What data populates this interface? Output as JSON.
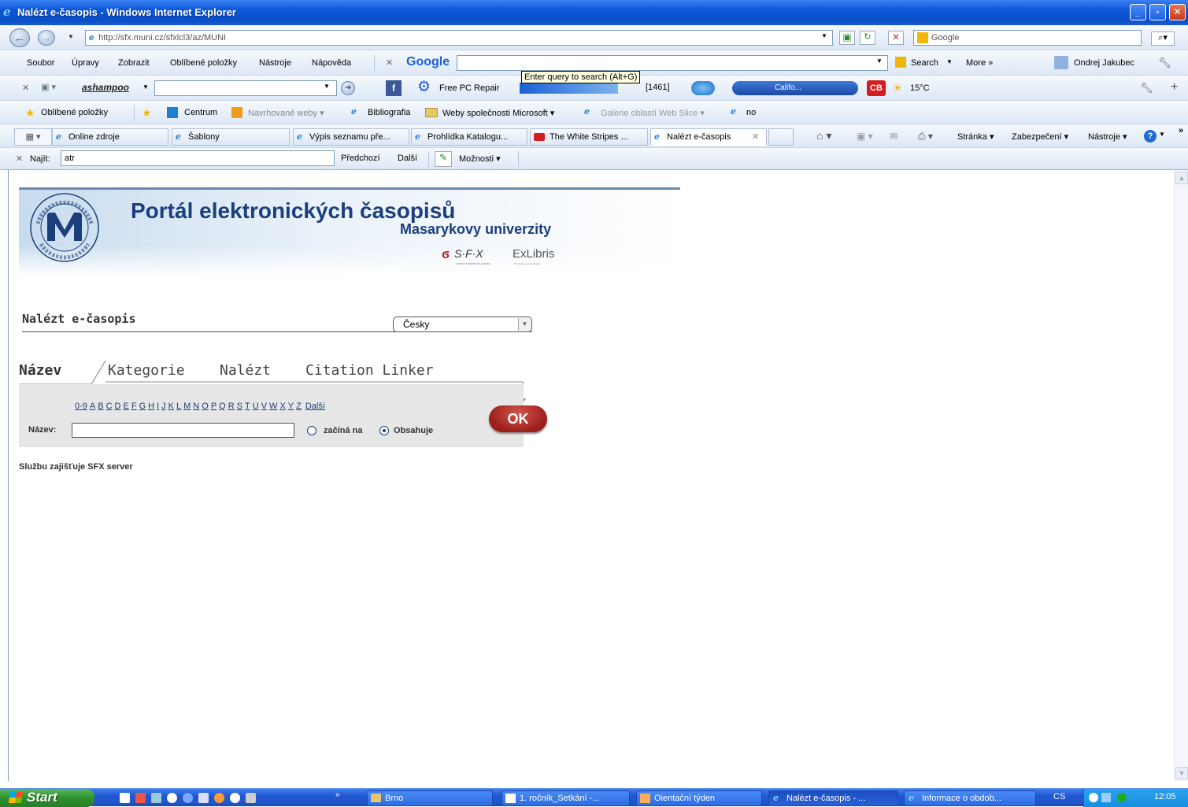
{
  "window": {
    "title": "Nalézt e-časopis - Windows Internet Explorer",
    "minimize": "_",
    "maximize": "▫",
    "close": "✕"
  },
  "address_bar": {
    "url": "http://sfx.muni.cz/sfxlcl3/az/MUNI",
    "search_placeholder": "Google"
  },
  "menu": {
    "items": [
      "Soubor",
      "Úpravy",
      "Zobrazit",
      "Oblíbené položky",
      "Nástroje",
      "Nápověda"
    ]
  },
  "google_toolbar": {
    "logo": "Google",
    "search_button": "Search",
    "more": "More »",
    "user": "Ondrej Jakubec"
  },
  "tooltip": "Enter query to search (Alt+G)",
  "ashampoo_toolbar": {
    "logo": "ashampoo",
    "free_pc_repair": "Free PC Repair",
    "mail_count": "[1461]",
    "radio": "Califo...",
    "cb": "CB",
    "weather": "15°C"
  },
  "favorites_bar": {
    "favorites_label": "Oblíbené položky",
    "items": [
      "Centrum",
      "Navrhované weby ▾",
      "Bibliografia",
      "Weby společnosti Microsoft ▾",
      "Galerie oblastí Web Slice ▾",
      "no"
    ]
  },
  "tabs": [
    {
      "label": "Online zdroje"
    },
    {
      "label": "Šablony"
    },
    {
      "label": "Výpis seznamu pře..."
    },
    {
      "label": "Prohlídka Katalogu..."
    },
    {
      "label": "The White Stripes ..."
    },
    {
      "label": "Nalézt e-časopis"
    }
  ],
  "command_bar": {
    "page": "Stránka ▾",
    "security": "Zabezpečení ▾",
    "tools": "Nástroje ▾",
    "more": "»"
  },
  "find_bar": {
    "label": "Najít:",
    "value": "atr",
    "prev": "Předchozí",
    "next": "Další",
    "options": "Možnosti ▾"
  },
  "page": {
    "banner": {
      "title": "Portál elektronických časopisů",
      "subtitle": "Masarykovy univerzity",
      "logo_letters": "MU",
      "sfx": "S·F·X",
      "sfx_tag": "CONTEXT SENSITIVE LINKING",
      "exlibris": "ExLibris",
      "exlibris_tag": "The bridge to knowledge"
    },
    "heading": "Nalézt e-časopis",
    "language": "Česky",
    "search_tabs": [
      "Název",
      "Kategorie",
      "Nalézt",
      "Citation Linker"
    ],
    "letters": [
      "0-9",
      "A",
      "B",
      "C",
      "D",
      "E",
      "F",
      "G",
      "H",
      "I",
      "J",
      "K",
      "L",
      "M",
      "N",
      "O",
      "P",
      "Q",
      "R",
      "S",
      "T",
      "U",
      "V",
      "W",
      "X",
      "Y",
      "Z",
      "Další"
    ],
    "title_label": "Název:",
    "title_value": "",
    "starts_with": "začíná na",
    "contains": "Obsahuje",
    "ok": "OK",
    "footer": "Službu zajišťuje SFX server"
  },
  "taskbar": {
    "start": "Start",
    "tasks": [
      "Brno",
      "1. ročník_Setkání -...",
      "Oientační týden",
      "Nalézt e-časopis - ...",
      "Informace o obdob..."
    ],
    "lang": "CS",
    "clock": "12:05"
  }
}
